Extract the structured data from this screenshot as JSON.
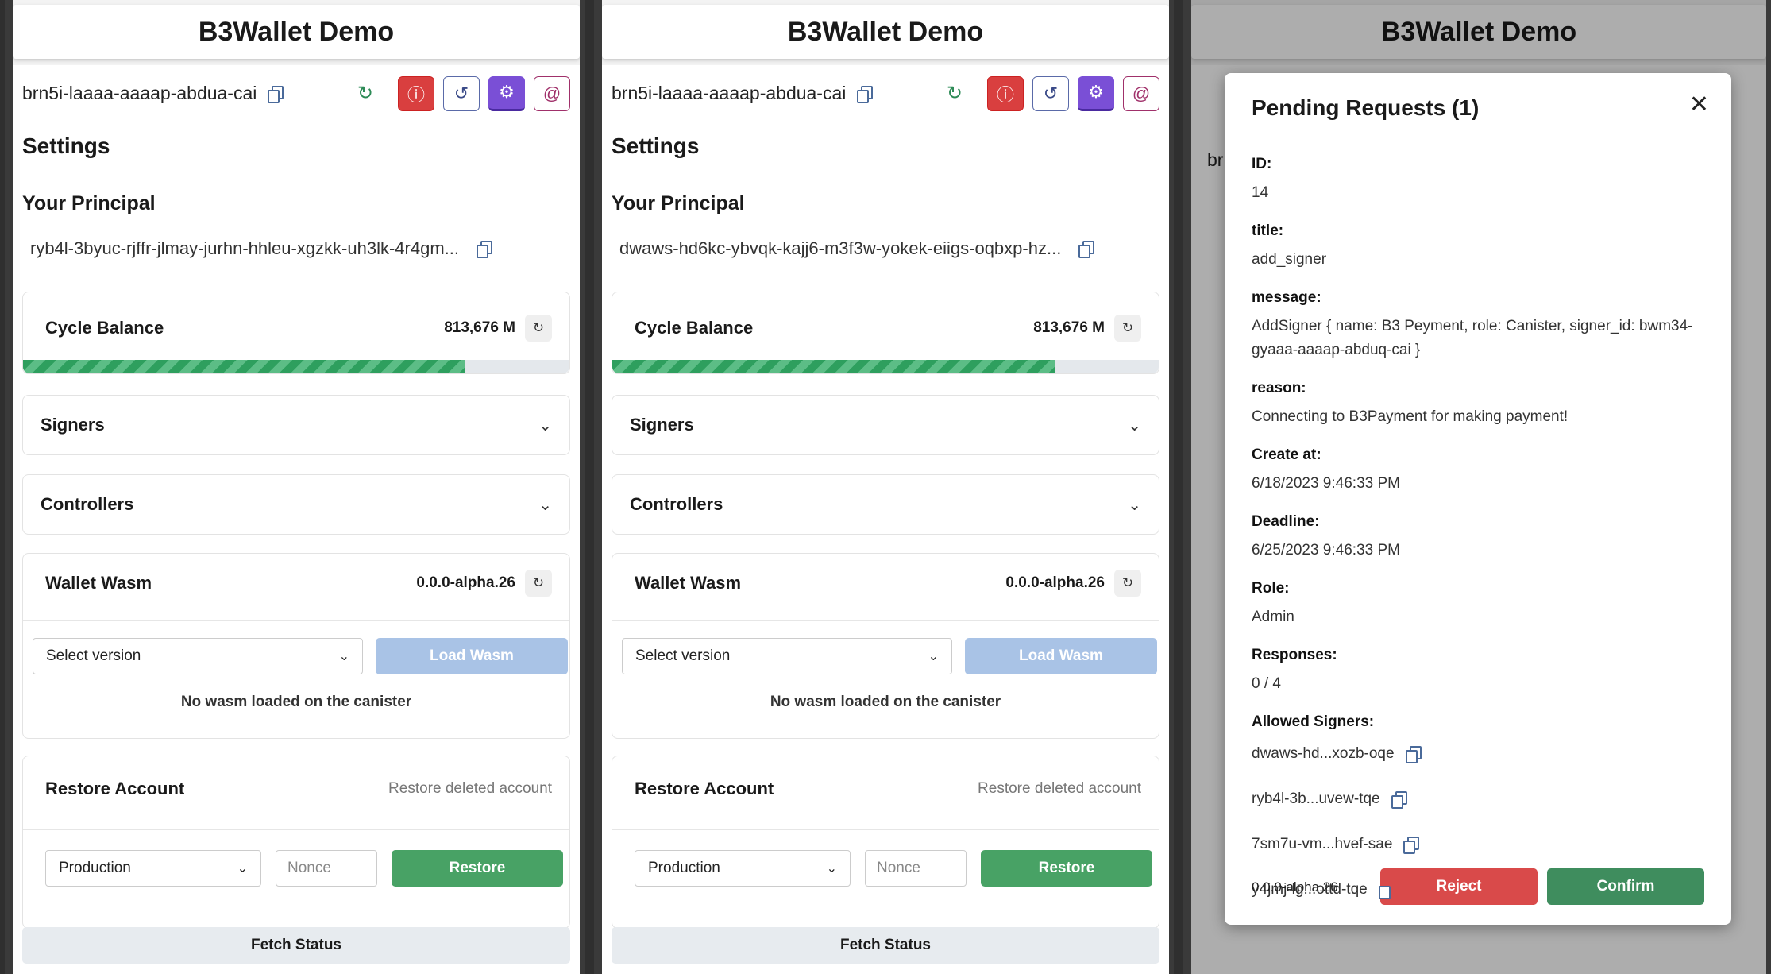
{
  "app_title": "B3Wallet Demo",
  "panels": [
    {
      "canister_id": "brn5i-laaaa-aaaap-abdua-cai",
      "settings_title": "Settings",
      "principal_heading": "Your Principal",
      "principal": "ryb4l-3byuc-rjffr-jlmay-jurhn-hhleu-xgzkk-uh3lk-4r4gm...",
      "cycle_label": "Cycle Balance",
      "cycle_value": "813,676 M",
      "cycle_progress_percent": 81,
      "signers_label": "Signers",
      "controllers_label": "Controllers",
      "wasm_label": "Wallet Wasm",
      "wasm_version": "0.0.0-alpha.26",
      "select_version": "Select version",
      "load_wasm": "Load Wasm",
      "no_wasm": "No wasm loaded on the canister",
      "restore_label": "Restore Account",
      "restore_hint": "Restore deleted account",
      "environment": "Production",
      "nonce_placeholder": "Nonce",
      "restore_button": "Restore",
      "fetch_status": "Fetch Status"
    },
    {
      "canister_id": "brn5i-laaaa-aaaap-abdua-cai",
      "settings_title": "Settings",
      "principal_heading": "Your Principal",
      "principal": "dwaws-hd6kc-ybvqk-kajj6-m3f3w-yokek-eiigs-oqbxp-hz...",
      "cycle_label": "Cycle Balance",
      "cycle_value": "813,676 M",
      "cycle_progress_percent": 81,
      "signers_label": "Signers",
      "controllers_label": "Controllers",
      "wasm_label": "Wallet Wasm",
      "wasm_version": "0.0.0-alpha.26",
      "select_version": "Select version",
      "load_wasm": "Load Wasm",
      "no_wasm": "No wasm loaded on the canister",
      "restore_label": "Restore Account",
      "restore_hint": "Restore deleted account",
      "environment": "Production",
      "nonce_placeholder": "Nonce",
      "restore_button": "Restore",
      "fetch_status": "Fetch Status"
    }
  ],
  "third_panel": {
    "peek_text": "brr"
  },
  "modal": {
    "title": "Pending Requests (1)",
    "fields": {
      "id_label": "ID:",
      "id": "14",
      "title_label": "title:",
      "title": "add_signer",
      "message_label": "message:",
      "message": "AddSigner { name: B3 Peyment, role: Canister, signer_id: bwm34-gyaaa-aaaap-abduq-cai }",
      "reason_label": "reason:",
      "reason": "Connecting to B3Payment for making payment!",
      "created_label": "Create at:",
      "created": "6/18/2023 9:46:33 PM",
      "deadline_label": "Deadline:",
      "deadline": "6/25/2023 9:46:33 PM",
      "role_label": "Role:",
      "role": "Admin",
      "responses_label": "Responses:",
      "responses": "0 / 4",
      "allowed_label": "Allowed Signers:"
    },
    "allowed_signers": [
      "dwaws-hd...xozb-oqe",
      "ryb4l-3b...uvew-tqe",
      "7sm7u-vm...hvef-sae",
      "y4jmj-lg...ottd-tqe"
    ],
    "version": "0.0.0-alpha.26",
    "reject": "Reject",
    "confirm": "Confirm"
  },
  "icons": {
    "refresh": "↻",
    "info": "ⓘ",
    "history": "↺",
    "gear": "⚙",
    "at": "@",
    "chevron": "⌄",
    "close": "✕"
  },
  "colors": {
    "danger": "#d93f3f",
    "accent": "#7a4fd6",
    "success": "#48a265",
    "confirm": "#3f8d5e"
  }
}
